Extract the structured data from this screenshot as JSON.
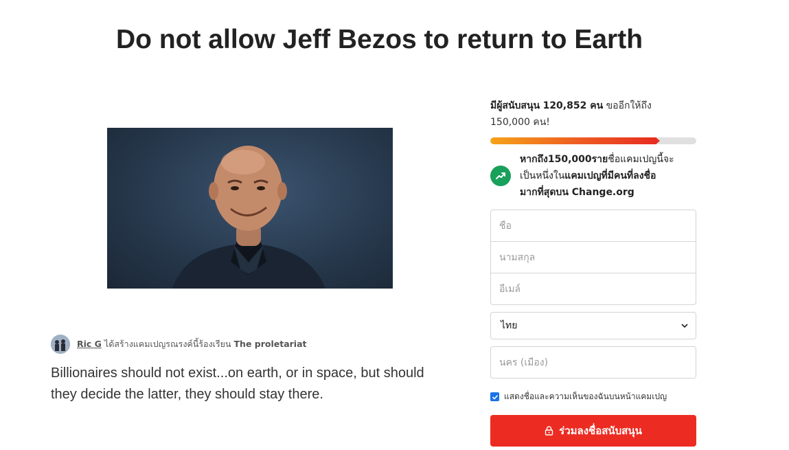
{
  "petition": {
    "title": "Do not allow Jeff Bezos to return to Earth",
    "image_alt": "Jeff Bezos",
    "creator_name": "Ric G",
    "created_text": "ได้สร้างแคมเปญรณรงค์นี้ร้องเรียน",
    "recipient": "The proletariat",
    "description": "Billionaires should not exist...on earth, or in space, but should they decide the latter, they should stay there."
  },
  "signatures": {
    "prefix": "มีผู้สนับสนุน",
    "count_text": "120,852 คน",
    "suffix": "ขออีกให้ถึง",
    "goal_text": "150,000 คน!",
    "progress_fraction": 0.805,
    "progress_colors": [
      "#f6a21a",
      "#e62d21"
    ]
  },
  "milestone": {
    "line1_bold": "หากถึง150,000ราย",
    "line1_normal": "ชื่อแคมเปญนี้จะ",
    "line2_normal": "เป็นหนึ่งใน",
    "line2_bold": "แคมเปญที่มีคนที่ลงชื่อ",
    "line3_bold": "มากที่สุดบน Change.org",
    "icon": "trending-up-icon",
    "badge_color": "#19a05b"
  },
  "form": {
    "first_name_placeholder": "ชื่อ",
    "last_name_placeholder": "นามสกุล",
    "email_placeholder": "อีเมล์",
    "country_value": "ไทย",
    "city_placeholder": "นคร (เมือง)",
    "consent_label": "แสดงชื่อและความเห็นของฉันบนหน้าแคมเปญ",
    "consent_checked": true,
    "submit_label": "ร่วมลงชื่อสนับสนุน",
    "submit_color": "#ec2c22"
  }
}
